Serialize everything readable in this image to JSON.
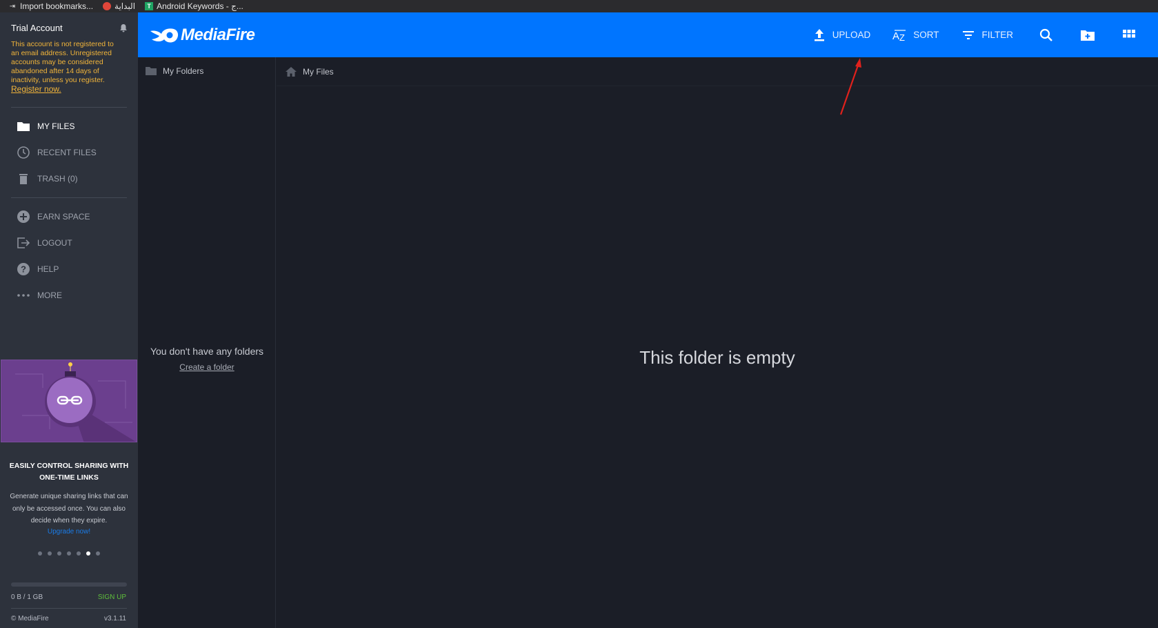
{
  "bookmarks": {
    "items": [
      {
        "label": "Import bookmarks...",
        "icon": "import-icon"
      },
      {
        "label": "البداية",
        "icon": "start-icon"
      },
      {
        "label": "Android Keywords - ج...",
        "icon": "keywords-icon"
      }
    ]
  },
  "sidebar": {
    "account_title": "Trial Account",
    "warning_text": "This account is not registered to an email address. Unregistered accounts may be considered abandoned after 14 days of inactivity, unless you register.",
    "register_link": "Register now.",
    "nav": [
      {
        "label": "MY FILES",
        "icon": "folder-icon"
      },
      {
        "label": "RECENT FILES",
        "icon": "clock-icon"
      },
      {
        "label": "TRASH (0)",
        "icon": "trash-icon"
      },
      {
        "label": "EARN SPACE",
        "icon": "plus-circle-icon"
      },
      {
        "label": "LOGOUT",
        "icon": "logout-icon"
      },
      {
        "label": "HELP",
        "icon": "help-icon"
      },
      {
        "label": "MORE",
        "icon": "more-icon"
      }
    ],
    "promo": {
      "title": "EASILY CONTROL SHARING WITH ONE-TIME LINKS",
      "text": "Generate unique sharing links that can only be accessed once. You can also decide when they expire.",
      "link": "Upgrade now!",
      "dot_count": 7,
      "active_dot": 6
    },
    "storage": {
      "used": "0 B / 1 GB",
      "fraction": 0,
      "signup": "SIGN UP"
    },
    "copyright": "© MediaFire",
    "version": "v3.1.11"
  },
  "topbar": {
    "logo_text": "MediaFire",
    "upload_label": "UPLOAD",
    "sort_label": "SORT",
    "filter_label": "FILTER"
  },
  "folders_pane": {
    "title": "My Folders",
    "empty_text": "You don't have any folders",
    "create_link": "Create a folder"
  },
  "files_pane": {
    "breadcrumb": "My Files",
    "empty_text": "This folder is empty"
  },
  "colors": {
    "brand_blue": "#0075ff",
    "sidebar_bg": "#2d323c",
    "content_bg": "#1b1e27",
    "warning": "#f2b53a",
    "signup_green": "#5fbf3b",
    "annotation_arrow": "#e0211c"
  }
}
